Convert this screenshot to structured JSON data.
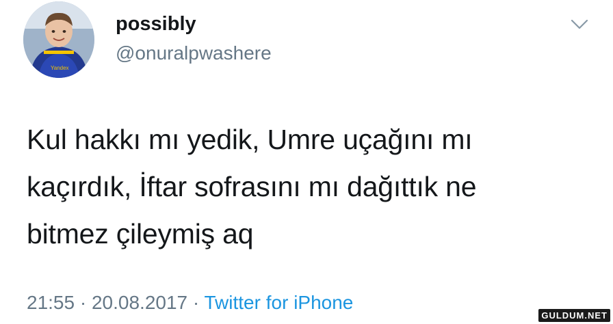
{
  "user": {
    "display_name": "possibly",
    "handle": "@onuralpwashere",
    "avatar_jersey_text": "Yandex"
  },
  "tweet": {
    "text": "Kul hakkı mı yedik, Umre uçağını mı\nkaçırdık, İftar sofrasını mı dağıttık ne\nbitmez çileymiş aq",
    "time": "21:55",
    "separator": "·",
    "date": "20.08.2017",
    "source": "Twitter for iPhone"
  },
  "watermark": "GULDUM.NET",
  "colors": {
    "text": "#14171a",
    "secondary": "#657786",
    "link": "#1b95e0"
  },
  "icons": {
    "menu": "chevron-down-icon"
  }
}
